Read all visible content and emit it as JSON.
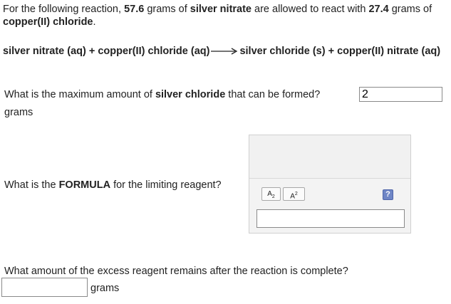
{
  "intro": {
    "text1": "For the following reaction, ",
    "mass1": "57.6",
    "text2": " grams of ",
    "reactant1": "silver nitrate",
    "text3": " are allowed to react with ",
    "mass2": "27.4",
    "text4": " grams of ",
    "reactant2": "copper(II) chloride",
    "text5": "."
  },
  "equation": {
    "left": "silver nitrate (aq) + copper(II) chloride (aq)",
    "right": "silver chloride (s) + copper(II) nitrate (aq)"
  },
  "q1": {
    "text_before": "What is the maximum amount of ",
    "bold": "silver chloride",
    "text_after": " that can be formed?",
    "answer": "2",
    "unit": "grams"
  },
  "q2": {
    "text_before": "What is the ",
    "bold": "FORMULA",
    "text_after": " for the limiting reagent?",
    "subscript_tool": "A",
    "subscript_mark": "2",
    "superscript_tool": "A",
    "superscript_mark": "2",
    "help_label": "?"
  },
  "q3": {
    "text": "What amount of the excess reagent remains after the reaction is complete?",
    "unit": "grams"
  },
  "colors": {
    "help_button": "#6f86c6",
    "widget_bg": "#f3f3f3"
  }
}
